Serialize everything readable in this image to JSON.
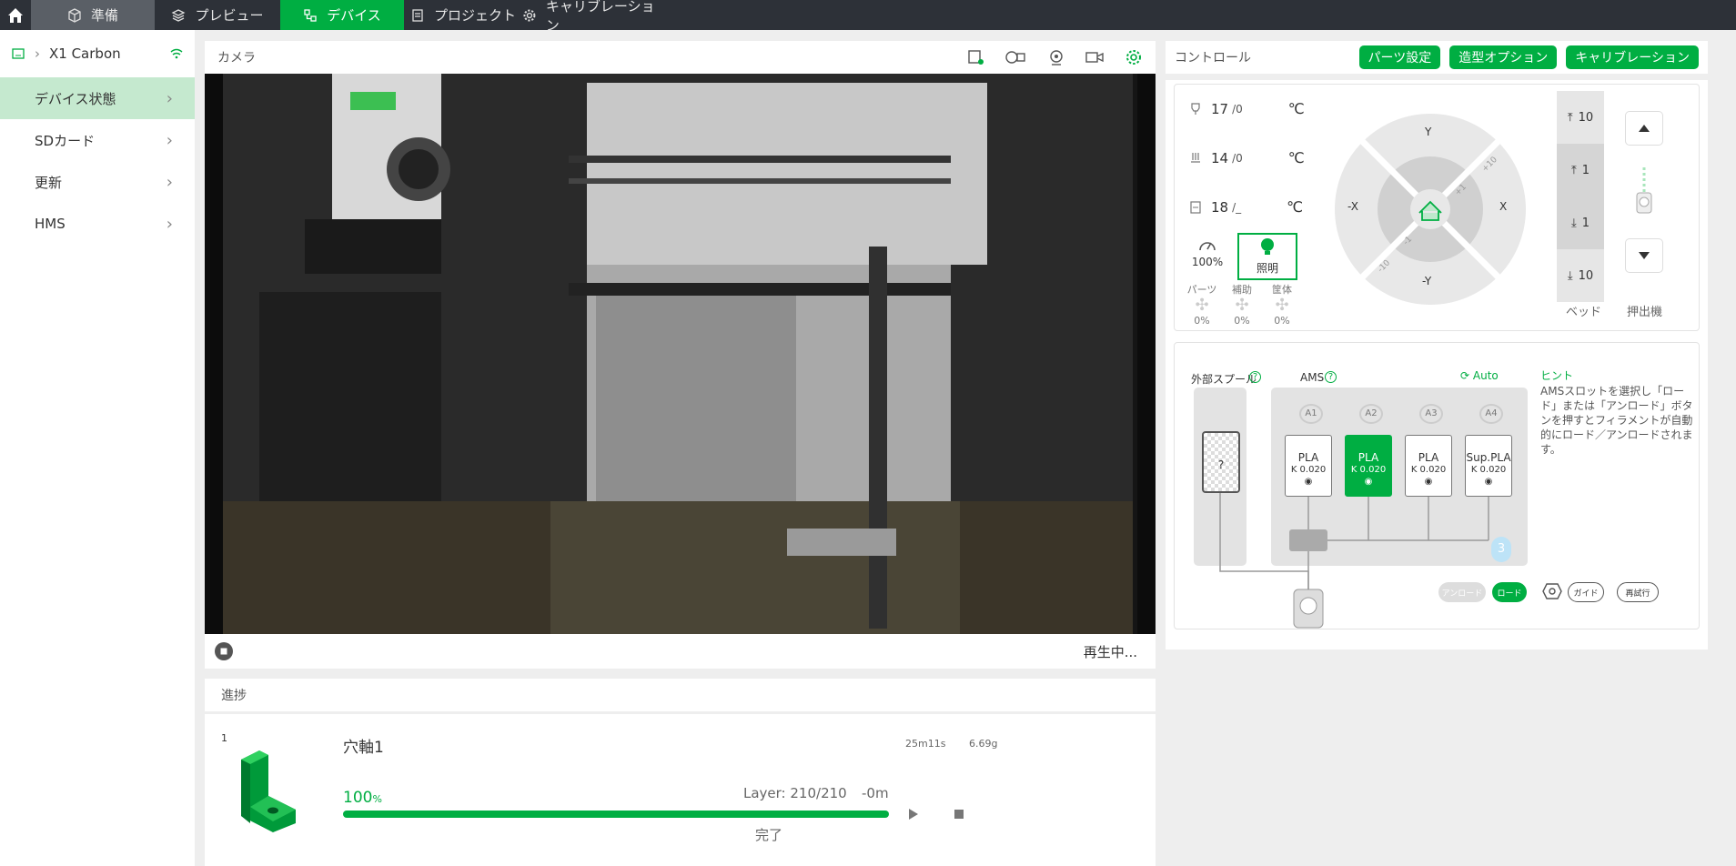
{
  "nav": {
    "tabs": [
      {
        "label": "準備",
        "icon": "cube-icon"
      },
      {
        "label": "プレビュー",
        "icon": "layers-icon"
      },
      {
        "label": "デバイス",
        "icon": "device-icon"
      },
      {
        "label": "プロジェクト",
        "icon": "document-icon"
      },
      {
        "label": "キャリブレーション",
        "icon": "gear-icon"
      }
    ]
  },
  "sidebar": {
    "device_name": "X1 Carbon",
    "items": [
      {
        "label": "デバイス状態"
      },
      {
        "label": "SDカード"
      },
      {
        "label": "更新"
      },
      {
        "label": "HMS"
      }
    ]
  },
  "camera": {
    "title": "カメラ",
    "status": "再生中..."
  },
  "progress": {
    "title": "進捗",
    "plate_number": "1",
    "job_name": "穴軸1",
    "time": "25m11s",
    "weight": "6.69g",
    "percent_value": "100",
    "percent_sign": "%",
    "layer": "Layer: 210/210",
    "remaining": "-0m",
    "state": "完了",
    "fraction": 1.0
  },
  "control": {
    "title": "コントロール",
    "buttons": [
      "パーツ設定",
      "造型オプション",
      "キャリブレーション"
    ],
    "temps": [
      {
        "value": "17",
        "target": "/0",
        "unit": "℃"
      },
      {
        "value": "14",
        "target": "/0",
        "unit": "℃"
      },
      {
        "value": "18",
        "target": "/_",
        "unit": "℃"
      }
    ],
    "speed": "100%",
    "light_label": "照明",
    "fans": [
      {
        "label": "パーツ",
        "value": "0%"
      },
      {
        "label": "補助",
        "value": "0%"
      },
      {
        "label": "筐体",
        "value": "0%"
      }
    ],
    "jog": {
      "y": "Y",
      "neg_y": "-Y",
      "x": "X",
      "neg_x": "-X",
      "plus10": "+10",
      "plus1": "+1",
      "minus1": "-1",
      "minus10": "-10"
    },
    "bed": {
      "up10": "10",
      "up1": "1",
      "down1": "1",
      "down10": "10",
      "label": "ベッド"
    },
    "extruder_label": "押出機"
  },
  "ams": {
    "external_label": "外部スプール",
    "ams_label": "AMS",
    "auto_label": "Auto",
    "external_slot": "?",
    "slot_labels": [
      "A1",
      "A2",
      "A3",
      "A4"
    ],
    "slots": [
      {
        "type": "PLA",
        "k": "K 0.020"
      },
      {
        "type": "PLA",
        "k": "K 0.020"
      },
      {
        "type": "PLA",
        "k": "K 0.020"
      },
      {
        "type": "Sup.PLA",
        "k": "K 0.020"
      }
    ],
    "humidity": "3",
    "hint_title": "ヒント",
    "hint_text": "AMSスロットを選択し「ロード」または「アンロード」ボタンを押すとフィラメントが自動的にロード／アンロードされます。",
    "unload": "アンロード",
    "load": "ロード",
    "guide": "ガイド",
    "retry": "再試行"
  },
  "colors": {
    "accent": "#00ae42",
    "nav_bg": "#2d3138"
  }
}
